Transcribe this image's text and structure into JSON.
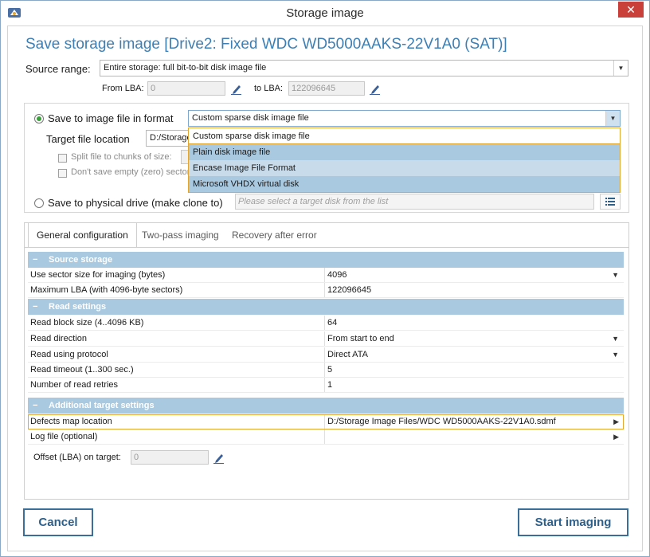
{
  "window": {
    "title": "Storage image",
    "close_label": "✕"
  },
  "heading": "Save storage image [Drive2: Fixed WDC WD5000AAKS-22V1A0 (SAT)]",
  "source": {
    "label": "Source range:",
    "value": "Entire storage: full bit-to-bit disk image file",
    "from_label": "From LBA:",
    "from_value": "0",
    "to_label": "to LBA:",
    "to_value": "122096645"
  },
  "save_file": {
    "label": "Save to image file in format",
    "format_value": "Custom sparse disk image file",
    "target_label": "Target file location",
    "target_value": "D:/Storage",
    "split_label": "Split file to chunks of size:",
    "empty_label": "Don't save empty (zero) sectors"
  },
  "format_options": [
    "Custom sparse disk image file",
    "Plain disk image file",
    "Encase Image File Format",
    "Microsoft VHDX virtual disk"
  ],
  "save_drive": {
    "label": "Save to physical drive (make clone to)",
    "placeholder": "Please select a target disk from the list"
  },
  "tabs": [
    {
      "label": "General configuration"
    },
    {
      "label": "Two-pass imaging"
    },
    {
      "label": "Recovery after error"
    }
  ],
  "sections": {
    "source_storage": "Source storage",
    "read_settings": "Read settings",
    "additional": "Additional target settings"
  },
  "props": {
    "sector_size": {
      "name": "Use sector size for imaging (bytes)",
      "value": "4096"
    },
    "max_lba": {
      "name": "Maximum LBA (with 4096-byte sectors)",
      "value": "122096645"
    },
    "block_size": {
      "name": "Read block size (4..4096 KB)",
      "value": "64"
    },
    "direction": {
      "name": "Read direction",
      "value": "From start to end"
    },
    "protocol": {
      "name": "Read using protocol",
      "value": "Direct ATA"
    },
    "timeout": {
      "name": "Read timeout (1..300 sec.)",
      "value": "5"
    },
    "retries": {
      "name": "Number of read retries",
      "value": "1"
    },
    "defects": {
      "name": "Defects map location",
      "value": "D:/Storage Image Files/WDC WD5000AAKS-22V1A0.sdmf"
    },
    "log": {
      "name": "Log file (optional)",
      "value": ""
    }
  },
  "offset": {
    "label": "Offset (LBA) on target:",
    "value": "0"
  },
  "buttons": {
    "cancel": "Cancel",
    "start": "Start imaging"
  },
  "colors": {
    "accent": "#3c7fb5",
    "section_header": "#a9c9e0",
    "highlight": "#e3a631",
    "close": "#c9403a"
  }
}
